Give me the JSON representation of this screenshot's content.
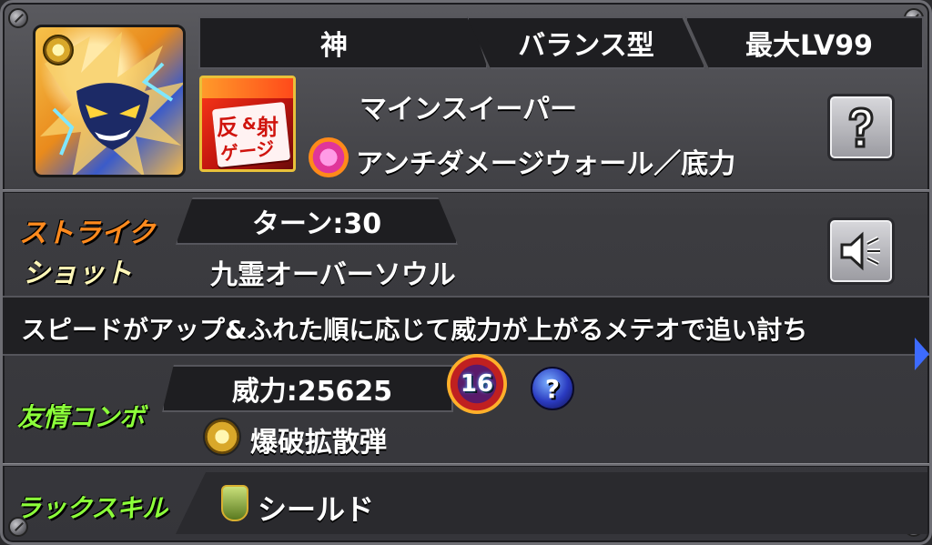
{
  "header": {
    "attribute": "神",
    "type": "バランス型",
    "max_level": "最大LV99"
  },
  "ability": {
    "gauge_badge_top": "反",
    "gauge_badge_top2": "射",
    "gauge_badge_amp": "&",
    "gauge_badge_bottom": "ゲージ",
    "ability_main": "マインスイーパー",
    "ability_gauge": "アンチダメージウォール／底力"
  },
  "strike_shot": {
    "label_line1": "ストライク",
    "label_line2": "ショット",
    "turns": "ターン:30",
    "name": "九霊オーバーソウル",
    "description": "スピードがアップ&ふれた順に応じて威力が上がるメテオで追い討ち"
  },
  "friend_combo": {
    "label": "友情コンボ",
    "power": "威力:25625",
    "badge_number": "16",
    "name": "爆破拡散弾"
  },
  "luck_skill": {
    "label": "ラックスキル",
    "name": "シールド"
  },
  "colors": {
    "orange_label": "#ff8a1e",
    "green_label": "#8cff3a",
    "gauge_red": "#d8261c",
    "panel_dark": "#1e1e21"
  },
  "icons": [
    "help-icon",
    "speaker-icon",
    "question-orb-icon",
    "badge-16-icon",
    "element-light-icon",
    "shield-icon"
  ]
}
